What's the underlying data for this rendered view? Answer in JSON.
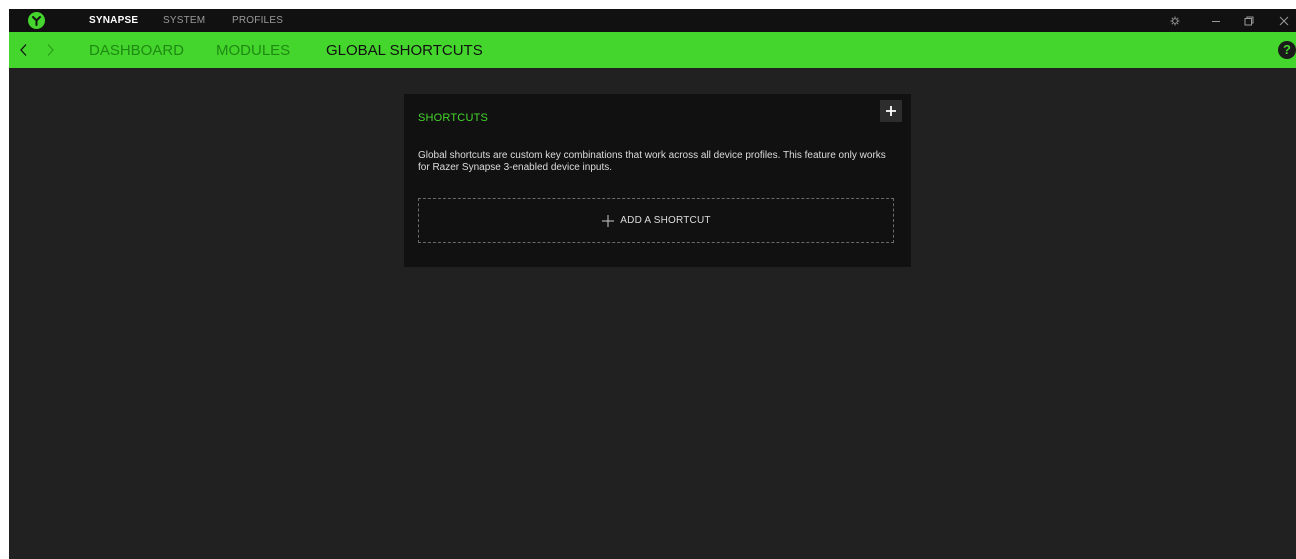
{
  "topbar": {
    "tabs": [
      {
        "label": "SYNAPSE",
        "active": true
      },
      {
        "label": "SYSTEM",
        "active": false
      },
      {
        "label": "PROFILES",
        "active": false
      }
    ],
    "window_controls": [
      "settings-icon",
      "minimize-icon",
      "maximize-icon",
      "close-icon"
    ]
  },
  "navbar": {
    "tabs": [
      {
        "label": "DASHBOARD",
        "active": false
      },
      {
        "label": "MODULES",
        "active": false
      },
      {
        "label": "GLOBAL SHORTCUTS",
        "active": true
      }
    ],
    "help_label": "?"
  },
  "card": {
    "title": "SHORTCUTS",
    "description": "Global shortcuts are custom key combinations that work across all device profiles. This feature only works for Razer Synapse 3-enabled device inputs.",
    "add_shortcut_label": "ADD A SHORTCUT"
  },
  "colors": {
    "accent": "#44d62c",
    "background": "#212121",
    "titlebar": "#111111",
    "card": "#111111"
  }
}
